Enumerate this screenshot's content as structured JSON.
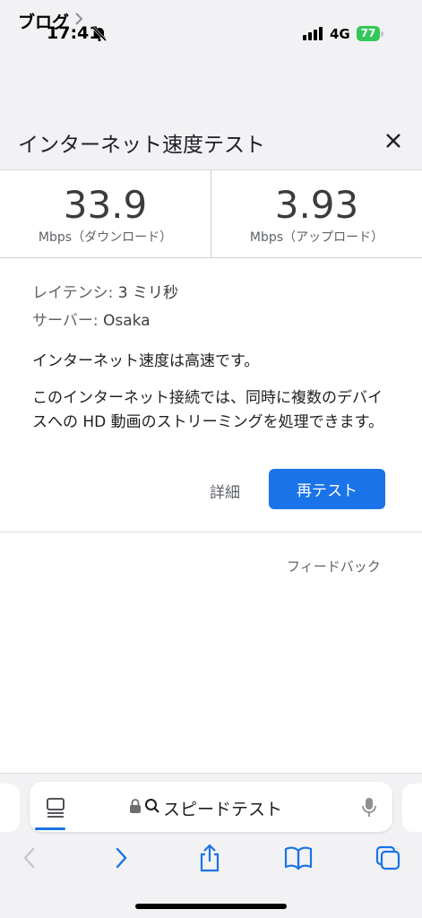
{
  "status_bar": {
    "time": "17:41",
    "network": "4G",
    "battery": "77"
  },
  "breadcrumb": {
    "label": "ブログ"
  },
  "header": {
    "title": "インターネット速度テスト"
  },
  "speeds": {
    "download": {
      "value": "33.9",
      "unit": "Mbps（ダウンロード）"
    },
    "upload": {
      "value": "3.93",
      "unit": "Mbps（アップロード）"
    }
  },
  "details": {
    "latency_label": "レイテンシ:",
    "latency_value": "3 ミリ秒",
    "server_label": "サーバー:",
    "server_value": "Osaka",
    "summary": "インターネット速度は高速です。",
    "description": "このインターネット接続では、同時に複数のデバイスへの HD 動画のストリーミングを処理できます。"
  },
  "actions": {
    "details_label": "詳細",
    "retest_label": "再テスト",
    "retest_color": "#1a73e8"
  },
  "feedback": {
    "label": "フィードバック"
  },
  "address_bar": {
    "text": "スピードテスト"
  },
  "icons": [
    "bell-slash-icon",
    "signal-icon",
    "chevron-right-icon",
    "close-icon",
    "page-menu-icon",
    "lock-icon",
    "search-icon",
    "mic-icon",
    "back-icon",
    "forward-icon",
    "share-icon",
    "bookmarks-icon",
    "tabs-icon"
  ]
}
